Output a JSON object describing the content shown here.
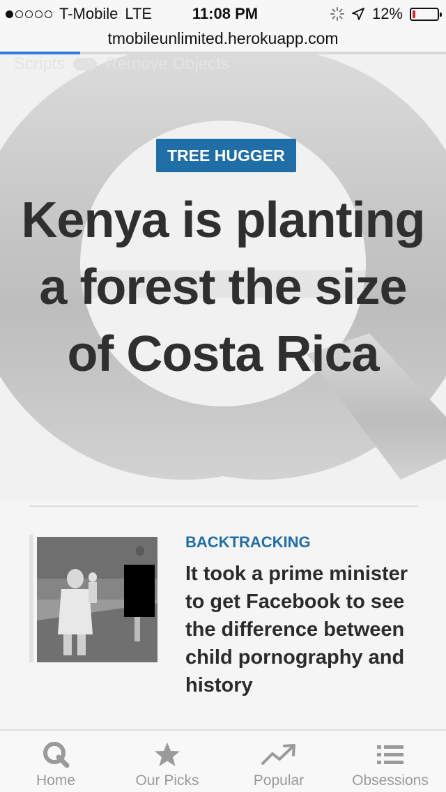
{
  "status_bar": {
    "carrier": "T-Mobile",
    "network": "LTE",
    "time": "11:08 PM",
    "battery_percent": "12%",
    "battery_level": 0.12,
    "signal_bars_filled": 1,
    "signal_bars_total": 5
  },
  "browser": {
    "url": "tmobileunlimited.herokuapp.com",
    "load_progress": 0.18
  },
  "overlay_toolbar": {
    "scripts_label": "Scripts",
    "remove_objects_label": "Remove Objects"
  },
  "hero": {
    "tag": "TREE HUGGER",
    "headline": "Kenya is planting a forest the size of Costa Rica"
  },
  "story": {
    "tag": "BACKTRACKING",
    "title": "It took a prime minister to get Facebook to see the difference between child pornography and history"
  },
  "tabs": [
    {
      "label": "Home",
      "icon": "q-logo-icon"
    },
    {
      "label": "Our Picks",
      "icon": "star-icon"
    },
    {
      "label": "Popular",
      "icon": "trending-icon"
    },
    {
      "label": "Obsessions",
      "icon": "list-icon"
    }
  ],
  "colors": {
    "accent": "#1f6ea8",
    "progress": "#2d7be0",
    "battery_low": "#e0262b"
  }
}
